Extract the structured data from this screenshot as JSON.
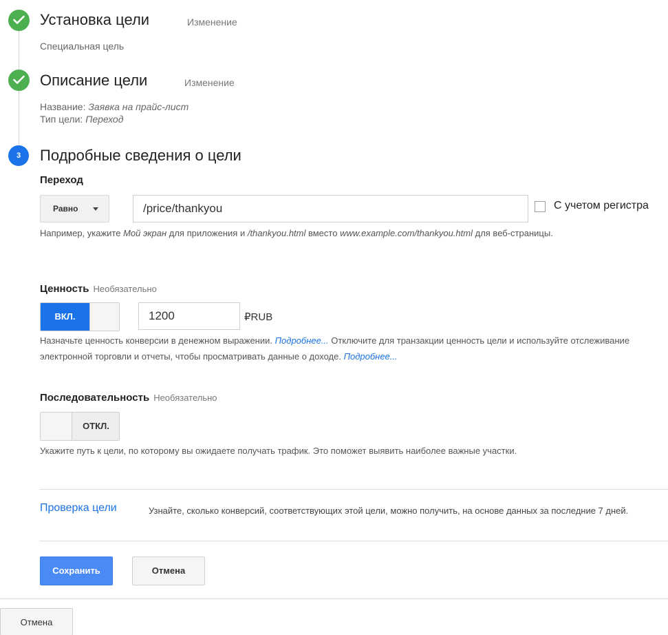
{
  "steps": [
    {
      "title": "Установка цели",
      "edit": "Изменение",
      "subtitle": "Специальная цель"
    },
    {
      "title": "Описание цели",
      "edit": "Изменение",
      "details": [
        {
          "label": "Название: ",
          "value": "Заявка на прайс-лист"
        },
        {
          "label": "Тип цели: ",
          "value": "Переход"
        }
      ]
    },
    {
      "number": "3",
      "title": "Подробные сведения о цели"
    }
  ],
  "destination": {
    "label": "Переход",
    "match_type": "Равно",
    "url_value": "/price/thankyou",
    "case_sensitive_label": "С учетом регистра",
    "help_prefix": "Например, укажите ",
    "help_app_example": "Мой экран",
    "help_mid": " для приложения и ",
    "help_page_example": "/thankyou.html",
    "help_mid2": " вместо ",
    "help_full_example": "www.example.com/thankyou.html",
    "help_suffix": " для веб-страницы."
  },
  "value": {
    "label": "Ценность",
    "optional": "Необязательно",
    "toggle_on_label": "ВКЛ.",
    "amount": "1200",
    "currency": "₽RUB",
    "help_1": "Назначьте ценность конверсии в денежном выражении. ",
    "link_1": "Подробнее...",
    "help_2": " Отключите для транзакции ценность цели и используйте отслеживание электронной торговли и отчеты, чтобы просматривать данные о доходе. ",
    "link_2": "Подробнее..."
  },
  "funnel": {
    "label": "Последовательность",
    "optional": "Необязательно",
    "toggle_off_label": "ОТКЛ.",
    "help": "Укажите путь к цели, по которому вы ожидаете получать трафик. Это поможет выявить наиболее важные участки."
  },
  "verify": {
    "link": "Проверка цели",
    "text": "Узнайте, сколько конверсий, соответствующих этой цели, можно получить, на основе данных за последние 7 дней."
  },
  "buttons": {
    "save": "Сохранить",
    "cancel": "Отмена",
    "cancel_bottom": "Отмена"
  },
  "colors": {
    "accent": "#1a73e8",
    "success": "#4caf50"
  },
  "icons": {
    "step_done": "check-circle-icon",
    "dropdown": "chevron-down-icon"
  }
}
